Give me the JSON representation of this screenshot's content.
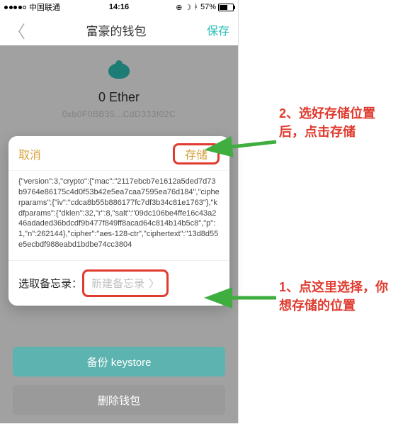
{
  "status": {
    "carrier": "中国联通",
    "time": "14:16",
    "battery_pct": "57%"
  },
  "nav": {
    "title": "富豪的钱包",
    "save": "保存"
  },
  "wallet": {
    "balance": "0 Ether",
    "address": "0xb0F0BB35...CdD333f02C"
  },
  "sheet": {
    "cancel": "取消",
    "store": "存储",
    "json_text": "{\"version\":3,\"crypto\":{\"mac\":\"2117ebcb7e1612a5ded7d73b9764e86175c4d0f53b42e5ea7caa7595ea76d184\",\"cipherparams\":{\"iv\":\"cdca8b55b886177fc7df3b34c81e1763\"},\"kdfparams\":{\"dklen\":32,\"r\":8,\"salt\":\"09dc106be4ffe16c43a246adaded36bdcdf9b477f849ff8acad64c814b14b5c8\",\"p\":1,\"n\":262144},\"cipher\":\"aes-128-ctr\",\"ciphertext\":\"13d8d55e5ecbdf988eabd1bdbe74cc3804",
    "memo_label": "选取备忘录：",
    "memo_placeholder": "新建备忘录"
  },
  "bottom": {
    "backup": "备份 keystore",
    "delete": "删除钱包"
  },
  "annotations": {
    "step1": "1、点这里选择，你想存储的位置",
    "step2": "2、选好存储位置后，点击存储"
  }
}
